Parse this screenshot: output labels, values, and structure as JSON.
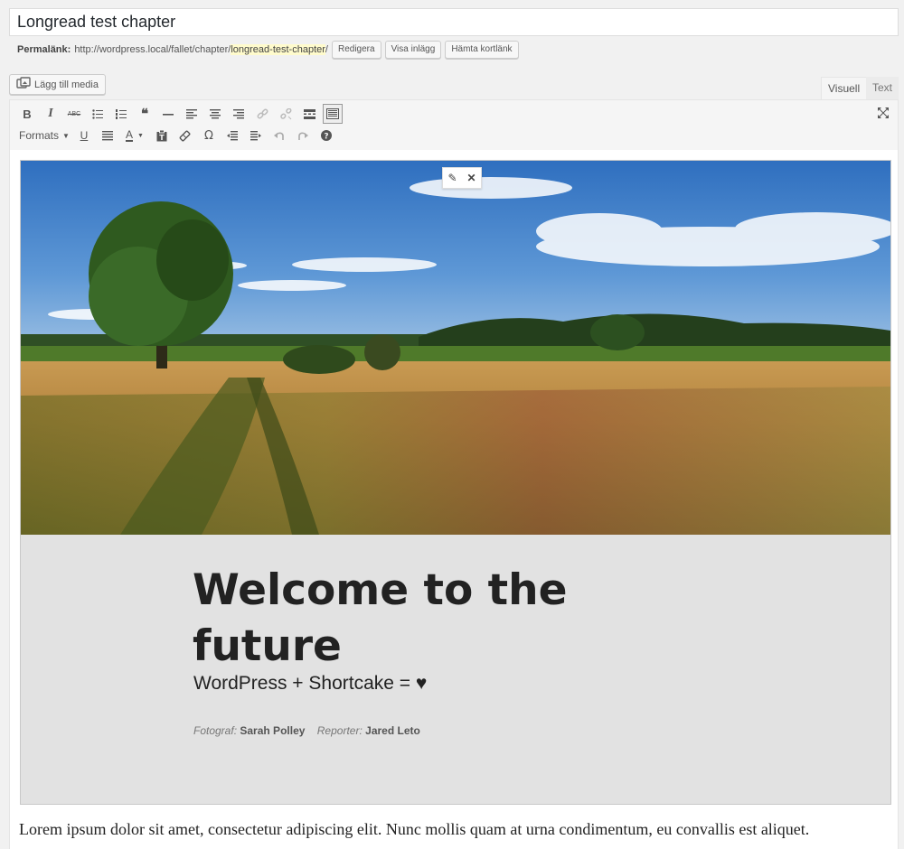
{
  "post": {
    "title": "Longread test chapter"
  },
  "permalink": {
    "label": "Permalänk:",
    "base": "http://wordpress.local/fallet/chapter/",
    "slug": "longread-test-chapter",
    "suffix": "/",
    "buttons": {
      "edit": "Redigera",
      "view": "Visa inlägg",
      "shortlink": "Hämta kortlänk"
    }
  },
  "media": {
    "add_label": "Lägg till media",
    "icon": "media-icon"
  },
  "tabs": {
    "visual": "Visuell",
    "text": "Text",
    "active": "visual"
  },
  "toolbar": {
    "formats_label": "Formats",
    "row1_icons": [
      "bold-icon",
      "italic-icon",
      "strikethrough-icon",
      "bullet-list-icon",
      "numbered-list-icon",
      "blockquote-icon",
      "horizontal-rule-icon",
      "align-left-icon",
      "align-center-icon",
      "align-right-icon",
      "link-icon",
      "unlink-icon",
      "read-more-icon",
      "toolbar-toggle-icon"
    ],
    "row2_icons": [
      "formats-dropdown",
      "underline-icon",
      "justify-icon",
      "text-color-icon",
      "paste-as-text-icon",
      "clear-formatting-icon",
      "special-character-icon",
      "outdent-icon",
      "indent-icon",
      "undo-icon",
      "redo-icon",
      "help-icon"
    ]
  },
  "shortcode": {
    "title": "Welcome to the future",
    "subtitle": "WordPress + Shortcake = ♥",
    "photographer_label": "Fotograf:",
    "photographer": "Sarah Polley",
    "reporter_label": "Reporter:",
    "reporter": "Jared Leto"
  },
  "content": {
    "paragraph": "Lorem ipsum dolor sit amet, consectetur adipiscing elit. Nunc mollis quam at urna condimentum, eu convallis est aliquet."
  },
  "colors": {
    "accent": "#0073aa",
    "block_bg": "#e2e2e2",
    "slug_highlight": "#fffbcc"
  }
}
